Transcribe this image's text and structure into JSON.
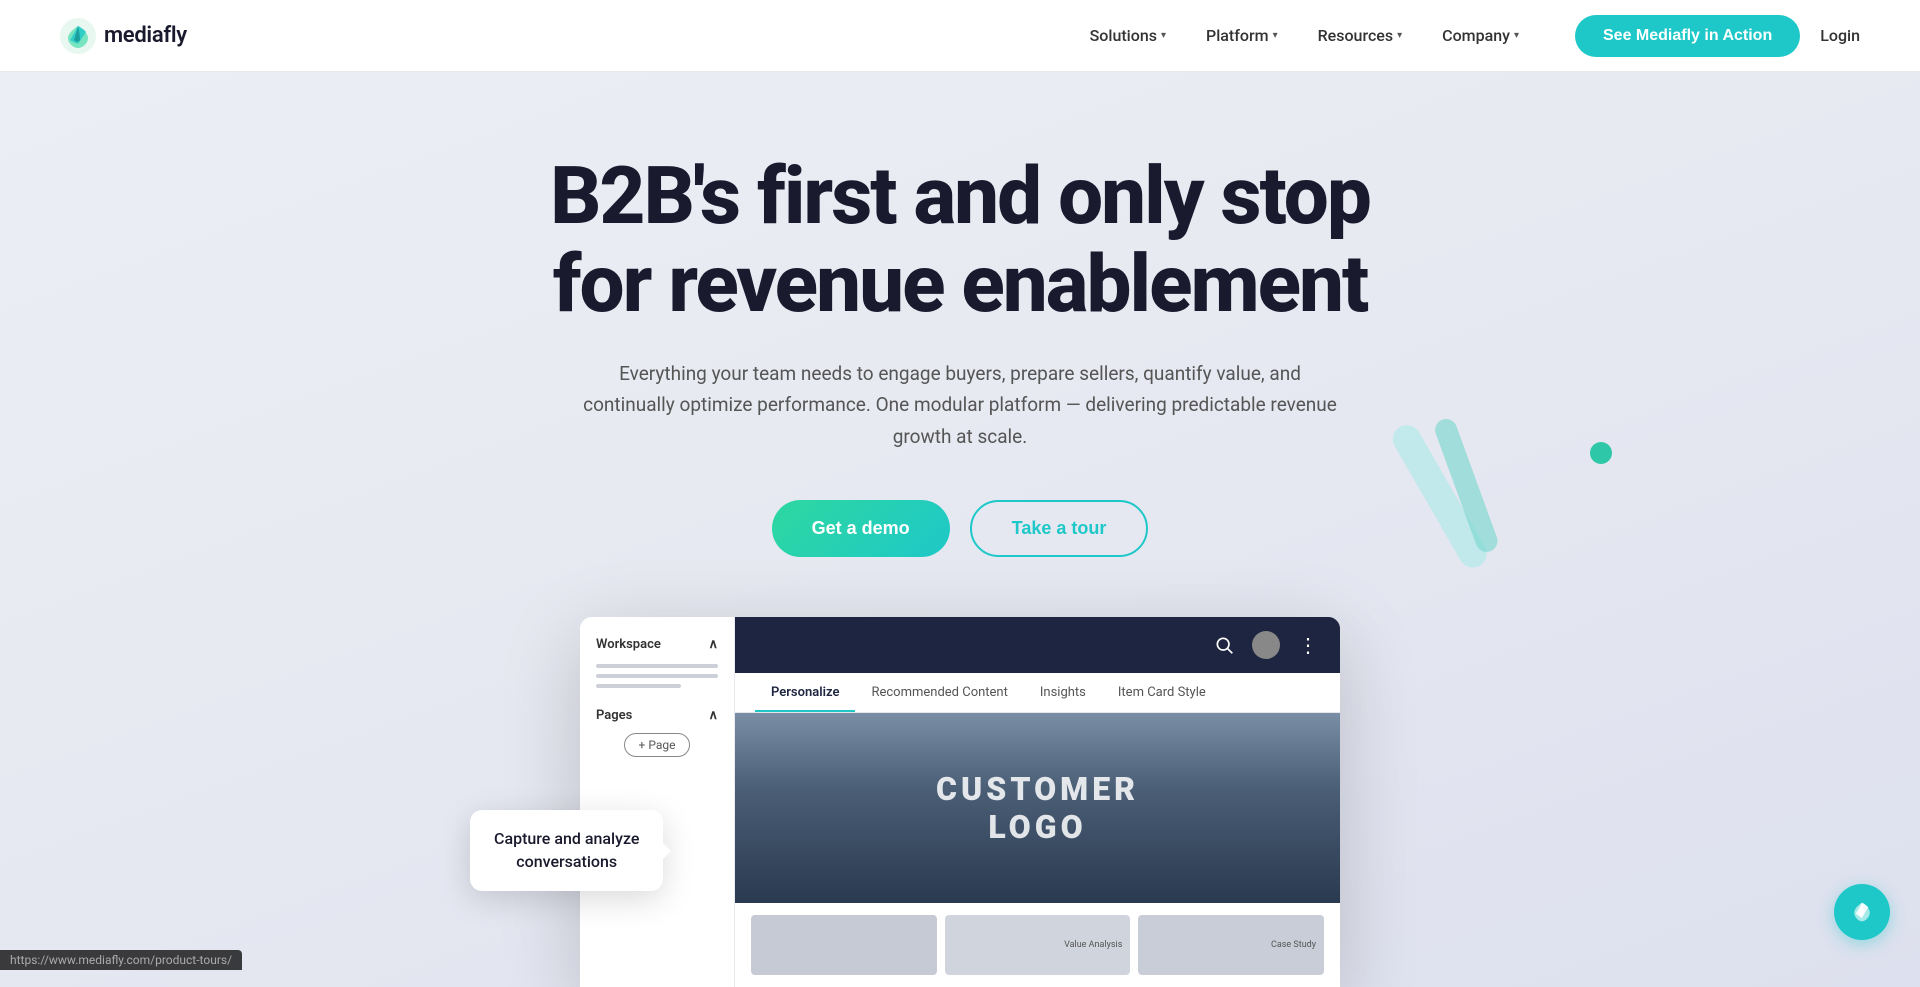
{
  "nav": {
    "logo_text": "mediafly",
    "links": [
      {
        "label": "Solutions",
        "has_chevron": true
      },
      {
        "label": "Platform",
        "has_chevron": true
      },
      {
        "label": "Resources",
        "has_chevron": true
      },
      {
        "label": "Company",
        "has_chevron": true
      }
    ],
    "cta_label": "See Mediafly in Action",
    "login_label": "Login"
  },
  "hero": {
    "title": "B2B's first and only stop for revenue enablement",
    "subtitle": "Everything your team needs to engage buyers, prepare sellers, quantify value, and continually optimize performance. One modular platform — delivering predictable revenue growth at scale.",
    "demo_button": "Get a demo",
    "tour_button": "Take a tour"
  },
  "app": {
    "sidebar": {
      "workspace_label": "Workspace",
      "pages_label": "Pages",
      "add_page": "+ Page"
    },
    "tabs": [
      "Personalize",
      "Recommended Content",
      "Insights",
      "Item Card Style"
    ],
    "active_tab": 0,
    "customer_logo_line1": "CUSTOMER LOGO",
    "customer_logo_line2": "",
    "thumbnails": [
      {
        "label": ""
      },
      {
        "label": "Value Analysis"
      },
      {
        "label": "Case Study"
      }
    ]
  },
  "tooltip": {
    "line1": "Capture and analyze",
    "line2": "conversations"
  },
  "status_bar": {
    "url": "https://www.mediafly.com/product-tours/"
  },
  "fab": {
    "icon": "🌿"
  }
}
